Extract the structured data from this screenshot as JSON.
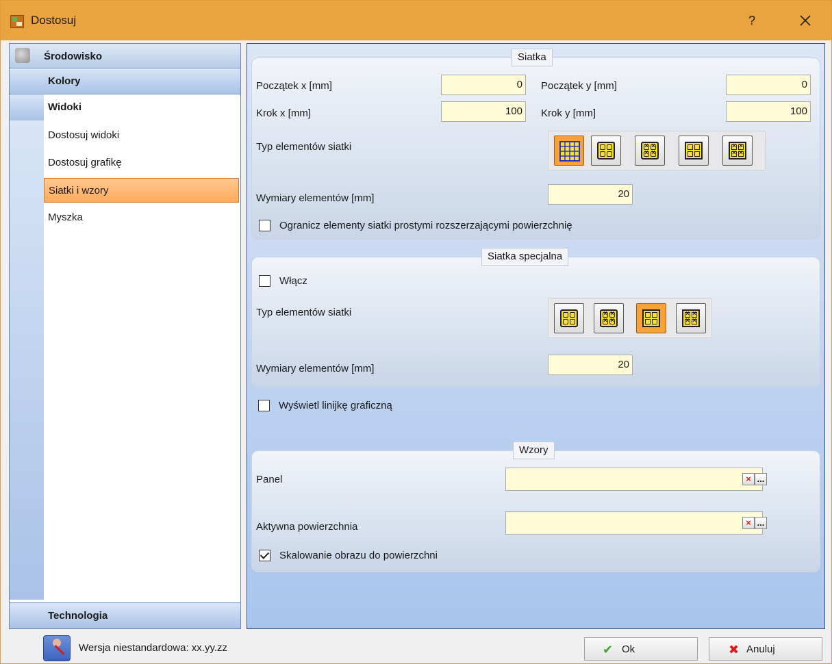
{
  "window": {
    "title": "Dostosuj",
    "help_label": "?"
  },
  "nav": {
    "environment": "Środowisko",
    "colors": "Kolory",
    "views": "Widoki",
    "items": [
      "Dostosuj widoki",
      "Dostosuj grafikę",
      "Siatki i wzory",
      "Myszka"
    ],
    "selected": "Siatki i wzory",
    "technology": "Technologia"
  },
  "grid": {
    "title": "Siatka",
    "origin_x_label": "Początek x [mm]",
    "origin_x": "0",
    "origin_y_label": "Początek y [mm]",
    "origin_y": "0",
    "step_x_label": "Krok x [mm]",
    "step_x": "100",
    "step_y_label": "Krok y [mm]",
    "step_y": "100",
    "element_type_label": "Typ elementów siatki",
    "element_size_label": "Wymiary elementów [mm]",
    "element_size": "20",
    "limit_label": "Ogranicz elementy siatki prostymi rozszerzającymi powierzchnię",
    "limit_checked": false
  },
  "special_grid": {
    "title": "Siatka specjalna",
    "enable_label": "Włącz",
    "enable_checked": false,
    "element_type_label": "Typ elementów siatki",
    "element_size_label": "Wymiary elementów [mm]",
    "element_size": "20"
  },
  "ruler": {
    "label": "Wyświetl linijkę graficzną",
    "checked": false
  },
  "patterns": {
    "title": "Wzory",
    "panel_label": "Panel",
    "panel_value": "",
    "surface_label": "Aktywna powierzchnia",
    "surface_value": "",
    "scale_label": "Skalowanie obrazu do powierzchni",
    "scale_checked": true,
    "clear_glyph": "×",
    "browse_glyph": "..."
  },
  "footer": {
    "version_text": "Wersja niestandardowa: xx.yy.zz",
    "ok_label": "Ok",
    "cancel_label": "Anuluj"
  },
  "colors": {
    "accent": "#e9a33f",
    "selected_item": "#ffab5c",
    "field_bg": "#fffbd6"
  },
  "icons": [
    "app-icon",
    "close-icon",
    "environment-icon",
    "grid-type-icons",
    "clear-icon",
    "browse-icon",
    "user-config-icon",
    "ok-check-icon",
    "cancel-x-icon"
  ]
}
